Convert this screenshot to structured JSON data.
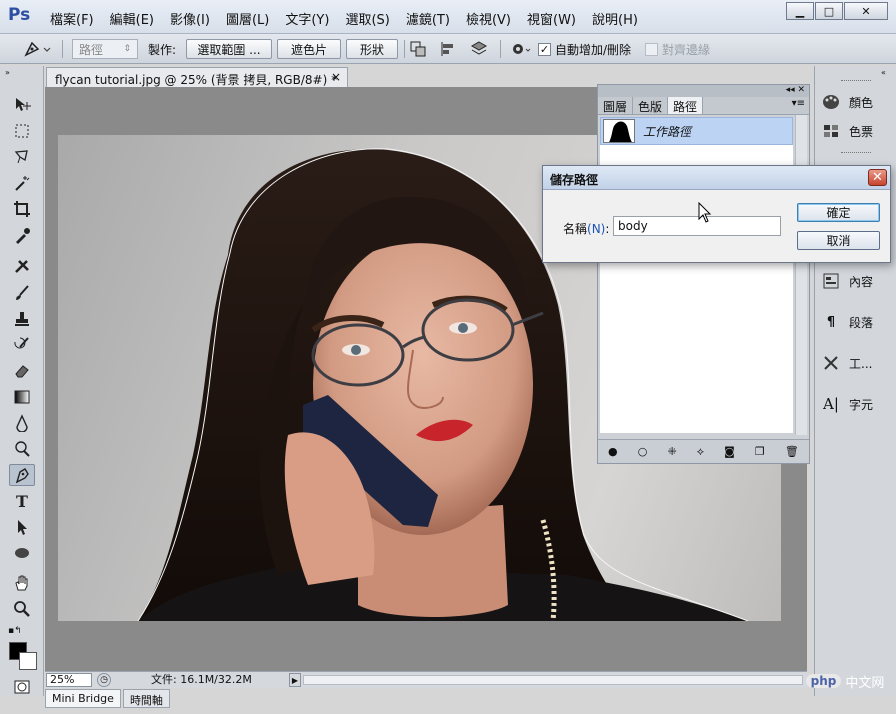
{
  "app": {
    "logo": "Ps",
    "menus": [
      "檔案(F)",
      "編輯(E)",
      "影像(I)",
      "圖層(L)",
      "文字(Y)",
      "選取(S)",
      "濾鏡(T)",
      "檢視(V)",
      "視窗(W)",
      "說明(H)"
    ],
    "window_buttons": {
      "minimize": "▁",
      "maximize": "□",
      "close": "✕"
    }
  },
  "options_bar": {
    "mode_select": "路徑",
    "make_label": "製作:",
    "make_selection_button": "選取範圍 ...",
    "mask_button": "遮色片",
    "shape_button": "形狀",
    "auto_add_delete_label": "自動增加/刪除",
    "auto_add_delete_checked": true,
    "align_edges_label": "對齊邊緣",
    "align_edges_checked": false
  },
  "document": {
    "tab_title": "flycan tutorial.jpg @ 25% (背景 拷貝, RGB/8#) *",
    "tab_close": "×",
    "zoom": "25%",
    "doc_info": "文件: 16.1M/32.2M"
  },
  "bottom_tabs": [
    "Mini Bridge",
    "時間軸"
  ],
  "paths_panel": {
    "tabs": [
      "圖層",
      "色版",
      "路徑"
    ],
    "active_tab": "路徑",
    "path_name": "工作路徑",
    "collapse_glyph": "◂◂ ✕",
    "menu_glyph": "▾≡"
  },
  "dock": {
    "items": [
      {
        "label": "顏色",
        "icon": "palette-icon"
      },
      {
        "label": "色票",
        "icon": "swatches-icon"
      },
      {
        "label": "內容",
        "icon": "properties-icon"
      },
      {
        "label": "段落",
        "icon": "paragraph-icon"
      },
      {
        "label": "工...",
        "icon": "tool-presets-icon"
      },
      {
        "label": "字元",
        "icon": "character-icon"
      }
    ]
  },
  "dialog": {
    "title": "儲存路徑",
    "name_label": "名稱",
    "name_hotkey": "(N)",
    "name_colon": ":",
    "name_value": "body",
    "ok_button": "確定",
    "cancel_button": "取消"
  },
  "watermark": {
    "badge": "php",
    "text": "中文网"
  },
  "colors": {
    "accent": "#2e4ea3",
    "selection": "#bcd3f4",
    "close_red": "#c7452f"
  }
}
